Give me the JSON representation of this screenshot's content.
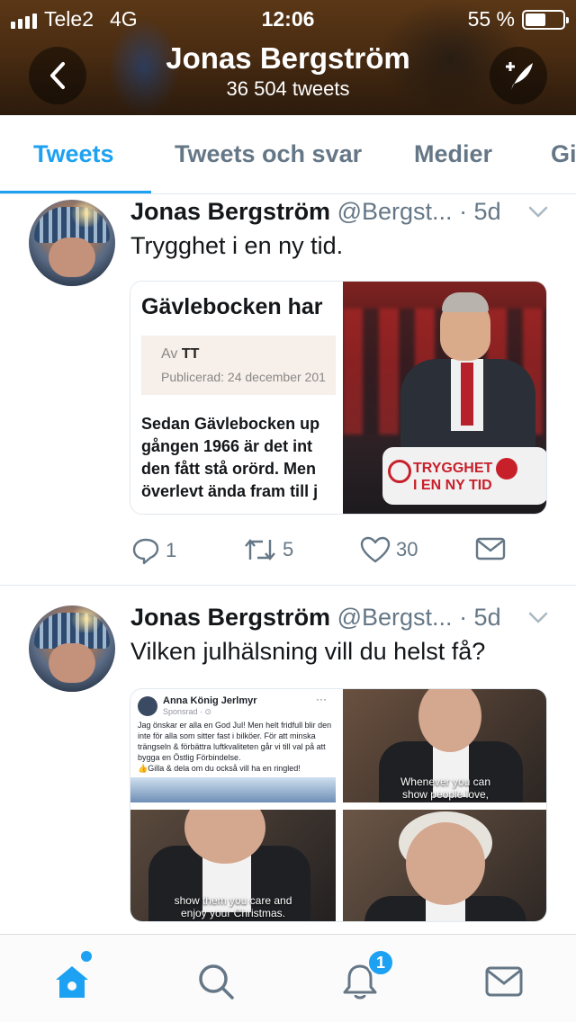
{
  "status_bar": {
    "carrier": "Tele2",
    "network": "4G",
    "time": "12:06",
    "battery": "55 %",
    "battery_level": 0.55
  },
  "header": {
    "title": "Jonas Bergström",
    "subtitle": "36 504 tweets"
  },
  "tabs": [
    {
      "label": "Tweets",
      "active": true
    },
    {
      "label": "Tweets och svar",
      "active": false
    },
    {
      "label": "Medier",
      "active": false
    },
    {
      "label": "Gi",
      "active": false
    }
  ],
  "tweets": [
    {
      "name": "Jonas Bergström",
      "handle": "@Bergst...",
      "time": "· 5d",
      "text": "Trygghet i en ny tid.",
      "media": {
        "news_headline": "Gävlebocken har",
        "news_byline_prefix": "Av",
        "news_byline_author": "TT",
        "news_published": "Publicerad: 24 december 201",
        "news_body": [
          "Sedan Gävlebocken up",
          "gången 1966 är det int",
          "den fått stå orörd. Men",
          "överlevt ända fram till j"
        ],
        "photo_sign": [
          "TRYGGHET",
          "I EN NY TID"
        ]
      },
      "actions": {
        "replies": "1",
        "retweets": "5",
        "likes": "30"
      }
    },
    {
      "name": "Jonas Bergström",
      "handle": "@Bergst...",
      "time": "· 5d",
      "text": "Vilken julhälsning vill du helst få?",
      "media": {
        "fb_name": "Anna König Jerlmyr",
        "fb_sponsored": "Sponsrad · ⊙",
        "fb_dots": "···",
        "fb_body": "Jag önskar er alla en God Jul! Men helt fridfull blir den inte för alla som sitter fast i bilköer. För att minska trängseln & förbättra luftkvaliteten går vi till val på att bygga en Östlig Förbindelse.",
        "fb_body2": "👍Gilla & dela om du också vill ha en ringled!",
        "caption_top_right": [
          "Whenever you can",
          "show people love,"
        ],
        "caption_bottom_left": [
          "show them you care and",
          "enjoy your Christmas."
        ]
      }
    }
  ],
  "bottom_nav": {
    "notifications_badge": "1"
  },
  "colors": {
    "accent": "#1da1f2",
    "text": "#14171a",
    "muted": "#657786",
    "border": "#e1e8ed"
  }
}
